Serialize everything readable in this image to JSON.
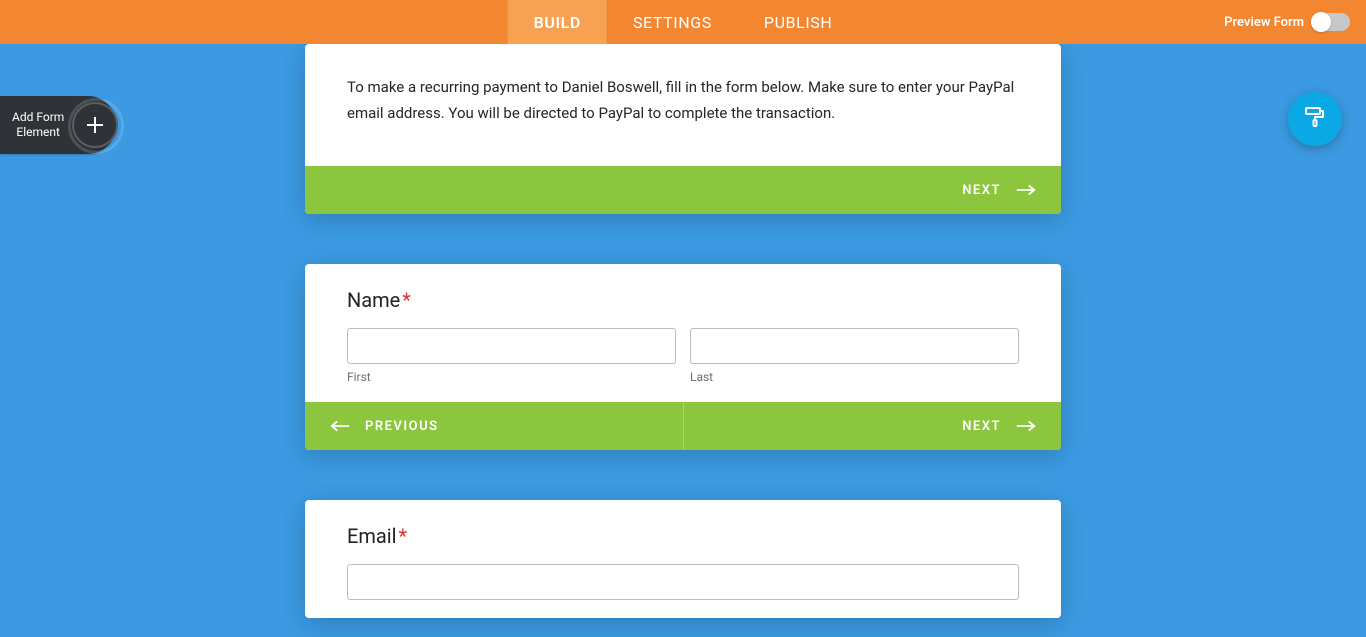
{
  "nav": {
    "tabs": [
      {
        "label": "BUILD",
        "active": true
      },
      {
        "label": "SETTINGS",
        "active": false
      },
      {
        "label": "PUBLISH",
        "active": false
      }
    ],
    "preview_label": "Preview Form",
    "preview_on": false
  },
  "left_panel": {
    "add_label_line1": "Add Form",
    "add_label_line2": "Element"
  },
  "cards": {
    "intro": {
      "text": "To make a recurring payment to Daniel Boswell, fill in the form below. Make sure to enter your PayPal email address. You will be directed to PayPal to complete the transaction.",
      "next": "NEXT"
    },
    "name": {
      "label": "Name",
      "required": "*",
      "first_sub": "First",
      "last_sub": "Last",
      "first_value": "",
      "last_value": "",
      "prev": "PREVIOUS",
      "next": "NEXT"
    },
    "email": {
      "label": "Email",
      "required": "*",
      "value": ""
    }
  },
  "colors": {
    "orange": "#f38630",
    "blue_bg": "#3b9ae1",
    "green": "#8cc63f",
    "roller": "#0ba8e6"
  }
}
